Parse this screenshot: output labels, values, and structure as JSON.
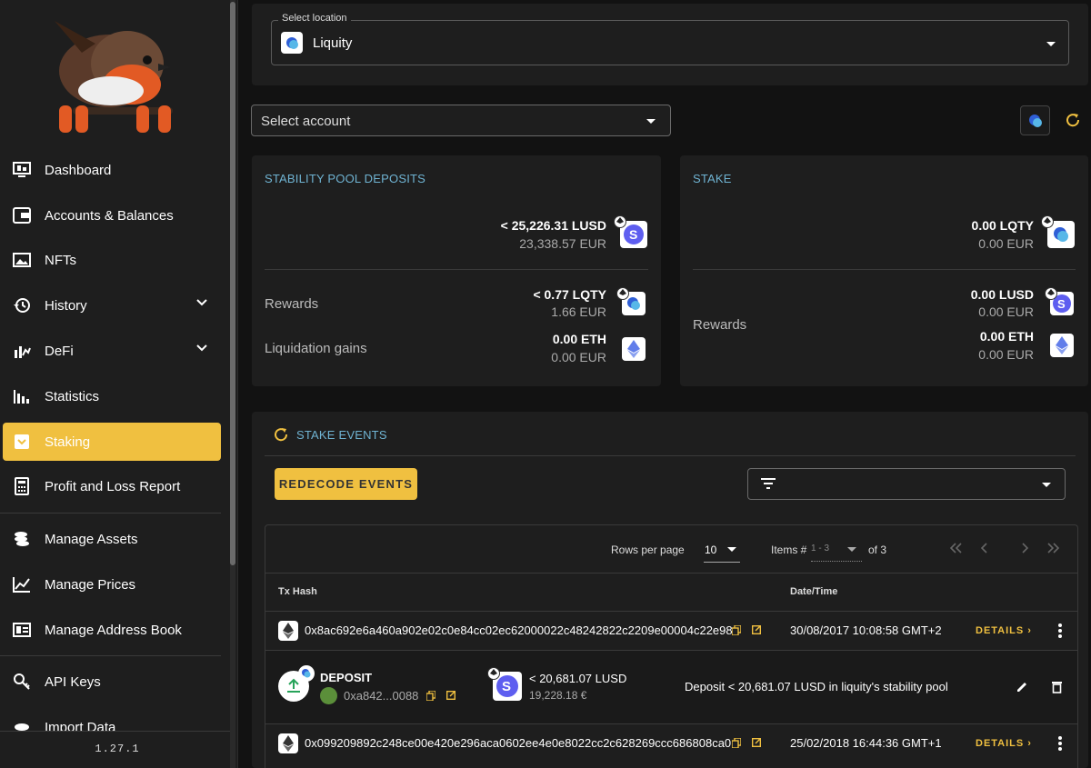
{
  "sidebar": {
    "items": [
      {
        "label": "Dashboard",
        "icon": "dashboard-icon"
      },
      {
        "label": "Accounts & Balances",
        "icon": "wallet-icon"
      },
      {
        "label": "NFTs",
        "icon": "image-icon"
      },
      {
        "label": "History",
        "icon": "history-icon"
      },
      {
        "label": "DeFi",
        "icon": "defi-icon"
      },
      {
        "label": "Statistics",
        "icon": "bar-chart-icon"
      },
      {
        "label": "Staking",
        "icon": "staking-icon"
      },
      {
        "label": "Profit and Loss Report",
        "icon": "calculator-icon"
      },
      {
        "label": "Manage Assets",
        "icon": "coins-icon"
      },
      {
        "label": "Manage Prices",
        "icon": "line-chart-icon"
      },
      {
        "label": "Manage Address Book",
        "icon": "address-book-icon"
      },
      {
        "label": "API Keys",
        "icon": "key-icon"
      },
      {
        "label": "Import Data",
        "icon": "import-icon"
      }
    ],
    "version": "1.27.1"
  },
  "location": {
    "legend": "Select location",
    "value": "Liquity"
  },
  "account": {
    "placeholder": "Select account"
  },
  "stability": {
    "title": "STABILITY POOL DEPOSITS",
    "deposit_amount": "< 25,226.31 LUSD",
    "deposit_fiat": "23,338.57 EUR",
    "rewards_label": "Rewards",
    "rewards_amount": "< 0.77 LQTY",
    "rewards_fiat": "1.66 EUR",
    "liq_label": "Liquidation gains",
    "liq_amount": "0.00 ETH",
    "liq_fiat": "0.00 EUR"
  },
  "stake": {
    "title": "STAKE",
    "stake_amount": "0.00 LQTY",
    "stake_fiat": "0.00 EUR",
    "rewards_label": "Rewards",
    "rw1_amount": "0.00 LUSD",
    "rw1_fiat": "0.00 EUR",
    "rw2_amount": "0.00 ETH",
    "rw2_fiat": "0.00 EUR"
  },
  "events": {
    "title": "STAKE EVENTS",
    "redecode_label": "REDECODE EVENTS",
    "rows_per_page_label": "Rows per page",
    "rows_per_page": "10",
    "items_label": "Items #",
    "items_range": "1 - 3",
    "of_total": "of 3",
    "col_txhash": "Tx Hash",
    "col_datetime": "Date/Time",
    "details_label": "DETAILS",
    "rows": [
      {
        "hash": "0x8ac692e6a460a902e02c0e84cc02ec62000022c48242822c2209e00004c22e98",
        "date": "30/08/2017 10:08:58 GMT+2"
      },
      {
        "hash": "0x099209892c248ce00e420e296aca0602ee4e0e8022cc2c628269ccc686808ca0",
        "date": "25/02/2018 16:44:36 GMT+1"
      }
    ],
    "sub": {
      "type": "DEPOSIT",
      "address": "0xa842...0088",
      "amount": "< 20,681.07 LUSD",
      "fiat": "19,228.18 €",
      "description": "Deposit < 20,681.07 LUSD in liquity's stability pool"
    }
  },
  "colors": {
    "accent": "#f0c040",
    "title_blue": "#6fb3d2",
    "bg": "#121212",
    "panel": "#1e1e1e"
  }
}
